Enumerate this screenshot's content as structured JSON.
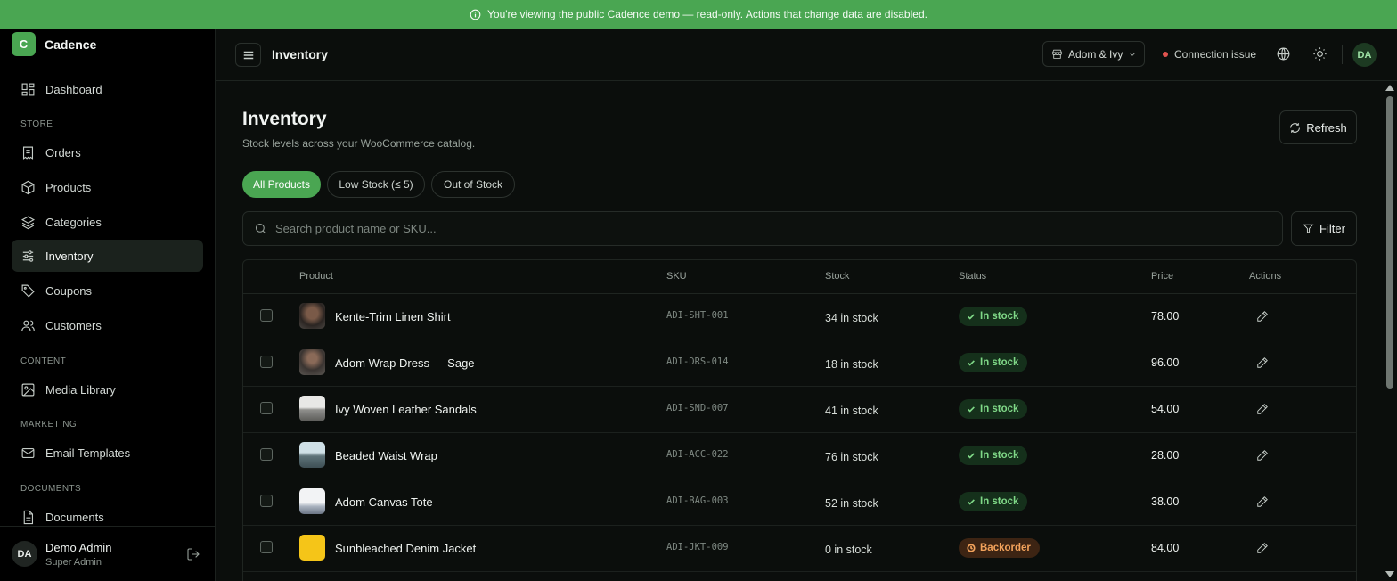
{
  "banner": {
    "text": "You're viewing the public Cadence demo — read-only. Actions that change data are disabled."
  },
  "brand": {
    "logo_letter": "C",
    "name": "Cadence",
    "color": "#4aa652"
  },
  "sidebar": {
    "dashboard": "Dashboard",
    "section_store": "STORE",
    "orders": "Orders",
    "products": "Products",
    "categories": "Categories",
    "inventory": "Inventory",
    "coupons": "Coupons",
    "customers": "Customers",
    "section_content": "CONTENT",
    "media_library": "Media Library",
    "section_marketing": "MARKETING",
    "email_templates": "Email Templates",
    "section_documents": "DOCUMENTS",
    "documents": "Documents",
    "active": "Inventory"
  },
  "user": {
    "initials": "DA",
    "name": "Demo Admin",
    "role": "Super Admin"
  },
  "topbar": {
    "title": "Inventory",
    "store": "Adom & Ivy",
    "connection": "Connection issue",
    "avatar_initials": "DA"
  },
  "page": {
    "title": "Inventory",
    "subtitle": "Stock levels across your WooCommerce catalog.",
    "refresh_label": "Refresh"
  },
  "filters": {
    "all": "All Products",
    "low": "Low Stock (≤ 5)",
    "out": "Out of Stock",
    "active": "All Products"
  },
  "search": {
    "placeholder": "Search product name or SKU...",
    "value": ""
  },
  "filter_label": "Filter",
  "table": {
    "headers": {
      "product": "Product",
      "sku": "SKU",
      "stock": "Stock",
      "status": "Status",
      "price": "Price",
      "actions": "Actions"
    },
    "rows": [
      {
        "name": "Kente-Trim Linen Shirt",
        "sku": "ADI-SHT-001",
        "stock": "34 in stock",
        "status": "In stock",
        "status_type": "ok",
        "price": "78.00"
      },
      {
        "name": "Adom Wrap Dress — Sage",
        "sku": "ADI-DRS-014",
        "stock": "18 in stock",
        "status": "In stock",
        "status_type": "ok",
        "price": "96.00"
      },
      {
        "name": "Ivy Woven Leather Sandals",
        "sku": "ADI-SND-007",
        "stock": "41 in stock",
        "status": "In stock",
        "status_type": "ok",
        "price": "54.00"
      },
      {
        "name": "Beaded Waist Wrap",
        "sku": "ADI-ACC-022",
        "stock": "76 in stock",
        "status": "In stock",
        "status_type": "ok",
        "price": "28.00"
      },
      {
        "name": "Adom Canvas Tote",
        "sku": "ADI-BAG-003",
        "stock": "52 in stock",
        "status": "In stock",
        "status_type": "ok",
        "price": "38.00"
      },
      {
        "name": "Sunbleached Denim Jacket",
        "sku": "ADI-JKT-009",
        "stock": "0 in stock",
        "status": "Backorder",
        "status_type": "backorder",
        "price": "84.00"
      }
    ]
  }
}
